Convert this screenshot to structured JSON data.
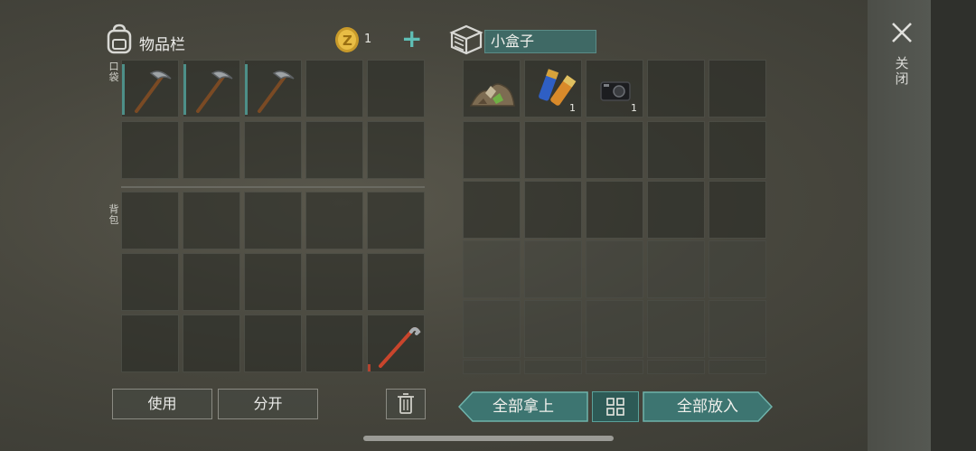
{
  "inventory": {
    "title": "物品栏",
    "coins": "1",
    "pocket_label": "口袋",
    "backpack_label": "背包",
    "pocket_slots": [
      {
        "item": "pickaxe-icon",
        "qty": ""
      },
      {
        "item": "pickaxe-icon",
        "qty": ""
      },
      {
        "item": "pickaxe-icon",
        "qty": ""
      },
      {
        "item": "",
        "qty": ""
      },
      {
        "item": "",
        "qty": ""
      }
    ],
    "backpack_last_item": "crowbar-icon"
  },
  "container": {
    "name": "小盒子",
    "slots": [
      {
        "item": "ore-pile-icon",
        "qty": ""
      },
      {
        "item": "batteries-icon",
        "qty": "1"
      },
      {
        "item": "camera-icon",
        "qty": "1"
      }
    ]
  },
  "buttons": {
    "use": "使用",
    "split": "分开",
    "take_all": "全部拿上",
    "put_all": "全部放入",
    "close": "关闭"
  },
  "colors": {
    "accent_teal": "#3f6965",
    "button_teal": "#3d7571",
    "slot_marker": "#4d8f88"
  }
}
